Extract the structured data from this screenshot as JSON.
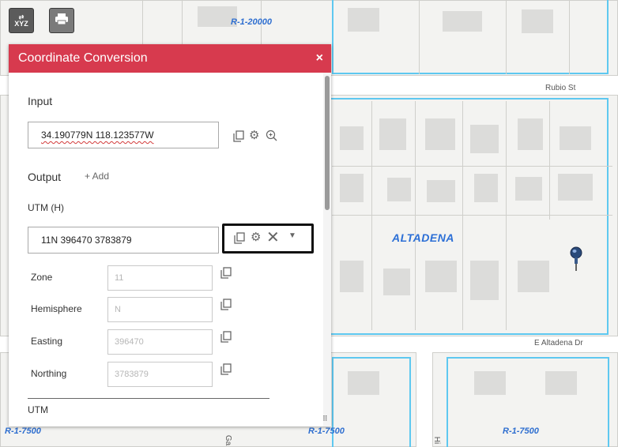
{
  "toolbar": {
    "xyz_button_label": "XYZ",
    "print_button_icon": "printer-icon"
  },
  "panel": {
    "title": "Coordinate Conversion",
    "close_label": "×",
    "input_section_label": "Input",
    "input_value": "34.190779N 118.123577W",
    "output_section_label": "Output",
    "add_label": "+ Add",
    "utm_h": {
      "label": "UTM (H)",
      "value": "11N 396470 3783879",
      "fields": [
        {
          "label": "Zone",
          "value": "11"
        },
        {
          "label": "Hemisphere",
          "value": "N"
        },
        {
          "label": "Easting",
          "value": "396470"
        },
        {
          "label": "Northing",
          "value": "3783879"
        }
      ]
    },
    "utm_label": "UTM"
  },
  "map": {
    "city_label": "ALTADENA",
    "streets": {
      "rubio": "Rubio St",
      "altadena_dr": "E Altadena Dr"
    },
    "zones": {
      "top": "R-1-20000",
      "bottom_left": "R-1-7500",
      "bottom_mid": "R-1-7500",
      "bottom_right": "R-1-7500"
    },
    "vertical_street_fragments": [
      "Ga",
      "Hi"
    ],
    "pin_icon": "map-pin-icon"
  },
  "colors": {
    "header": "#d73a4e",
    "zone_outline": "#5ec8f0",
    "label_blue": "#2c6fd6"
  }
}
